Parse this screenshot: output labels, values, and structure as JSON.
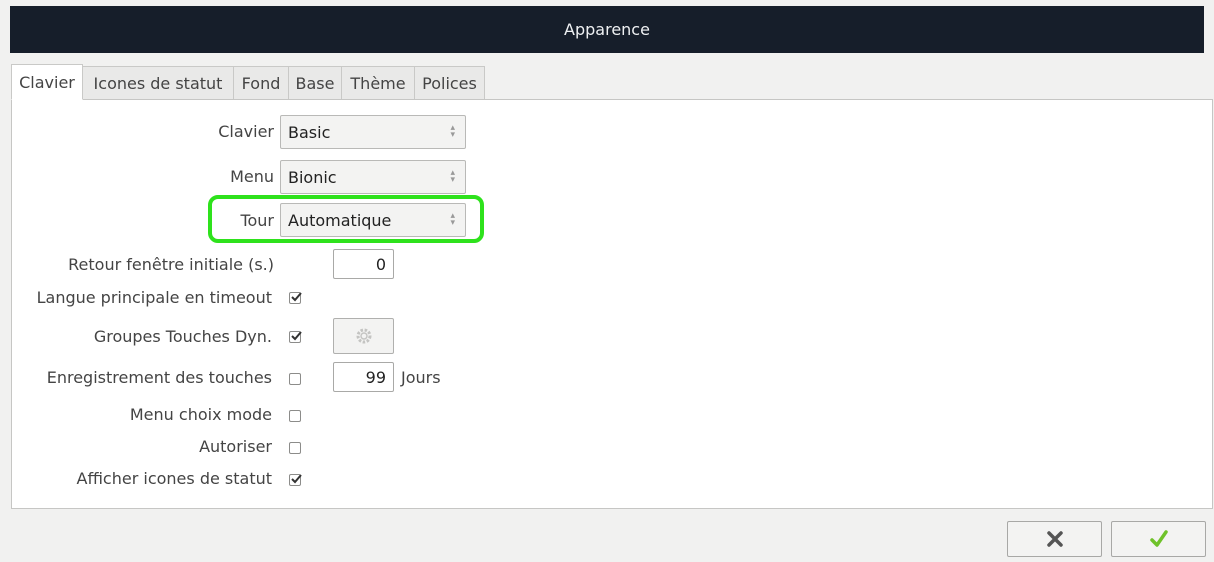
{
  "window": {
    "title": "Apparence"
  },
  "tabs": [
    {
      "label": "Clavier",
      "active": true
    },
    {
      "label": "Icones de statut",
      "active": false
    },
    {
      "label": "Fond",
      "active": false
    },
    {
      "label": "Base",
      "active": false
    },
    {
      "label": "Thème",
      "active": false
    },
    {
      "label": "Polices",
      "active": false
    }
  ],
  "form": {
    "clavier": {
      "label": "Clavier",
      "value": "Basic"
    },
    "menu": {
      "label": "Menu",
      "value": "Bionic"
    },
    "tour": {
      "label": "Tour",
      "value": "Automatique"
    },
    "retour": {
      "label": "Retour fenêtre initiale (s.)",
      "value": "0"
    },
    "langue": {
      "label": "Langue principale en timeout",
      "checked": true
    },
    "groupes": {
      "label": "Groupes Touches Dyn.",
      "checked": true,
      "settings_icon": "gear-icon"
    },
    "enregistrement": {
      "label": "Enregistrement des touches",
      "checked": false,
      "value": "99",
      "unit": "Jours"
    },
    "menu_choix": {
      "label": "Menu choix mode",
      "checked": false
    },
    "autoriser": {
      "label": "Autoriser",
      "checked": false
    },
    "afficher": {
      "label": "Afficher icones de statut",
      "checked": true
    }
  },
  "buttons": {
    "cancel_icon": "close-icon",
    "ok_icon": "checkmark-icon"
  },
  "colors": {
    "titlebar_bg": "#161e2a",
    "highlight": "#2ee21c",
    "ok_green": "#6fc22a"
  }
}
